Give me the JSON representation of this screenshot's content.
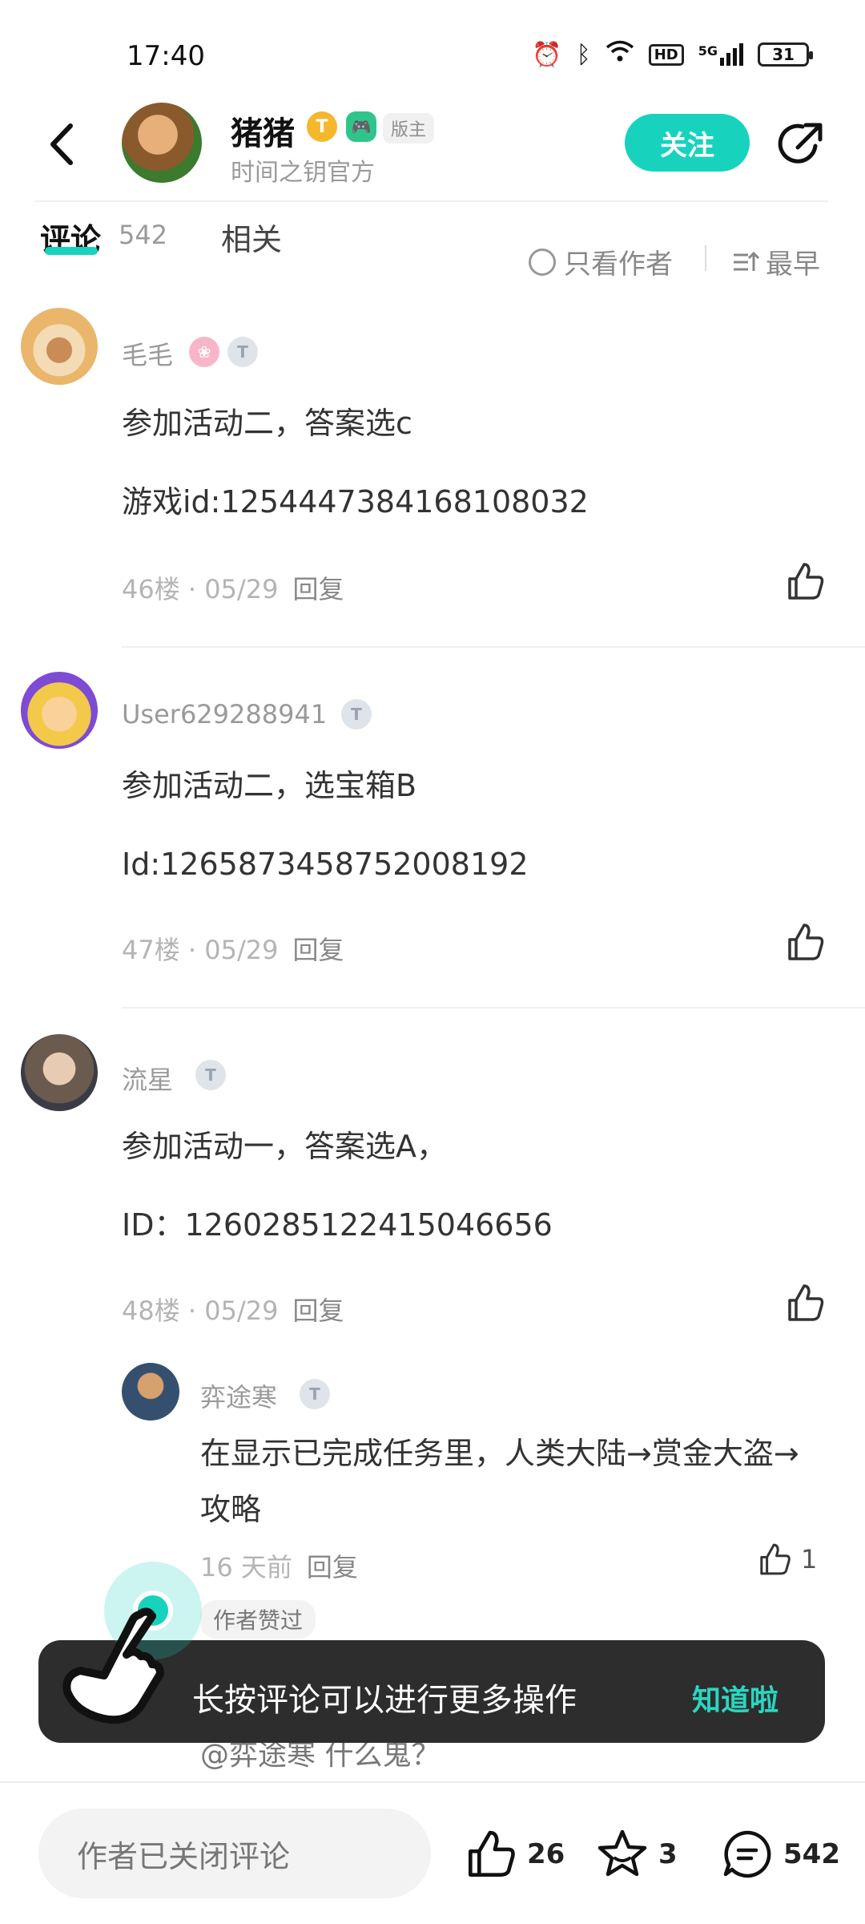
{
  "status": {
    "time": "17:40",
    "hd": "HD",
    "network": "5G",
    "battery": "31"
  },
  "header": {
    "author_name": "猪猪",
    "gold_badge": "T",
    "mod_label": "版主",
    "subtitle": "时间之钥官方",
    "follow_label": "关注"
  },
  "tabs": {
    "comments_label": "评论",
    "comments_count": "542",
    "related_label": "相关",
    "only_author_label": "只看作者",
    "sort_label": "最早"
  },
  "comments": [
    {
      "name": "毛毛",
      "lines": [
        "参加活动二，答案选c",
        "游戏id:1254447384168108032"
      ],
      "floor": "46楼 · 05/29",
      "reply": "回复"
    },
    {
      "name": "User629288941",
      "lines": [
        "参加活动二，选宝箱B",
        "Id:1265873458752008192"
      ],
      "floor": "47楼 · 05/29",
      "reply": "回复"
    },
    {
      "name": "流星",
      "lines": [
        "参加活动一，答案选A，",
        "ID：1260285122415046656"
      ],
      "floor": "48楼 · 05/29",
      "reply": "回复"
    }
  ],
  "reply": {
    "name": "弈途寒",
    "text": "在显示已完成任务里，人类大陆→赏金大盗→攻略",
    "time": "16 天前",
    "reply_label": "回复",
    "likes": "1",
    "author_liked": "作者赞过",
    "hidden_text": "@弈途寒 什么鬼？"
  },
  "toast": {
    "text": "长按评论可以进行更多操作",
    "action": "知道啦"
  },
  "bottom": {
    "input_placeholder": "作者已关闭评论",
    "like_count": "26",
    "star_count": "3",
    "comment_count": "542"
  },
  "colors": {
    "accent": "#17d3bd",
    "toast_bg": "#2d2d2d"
  }
}
